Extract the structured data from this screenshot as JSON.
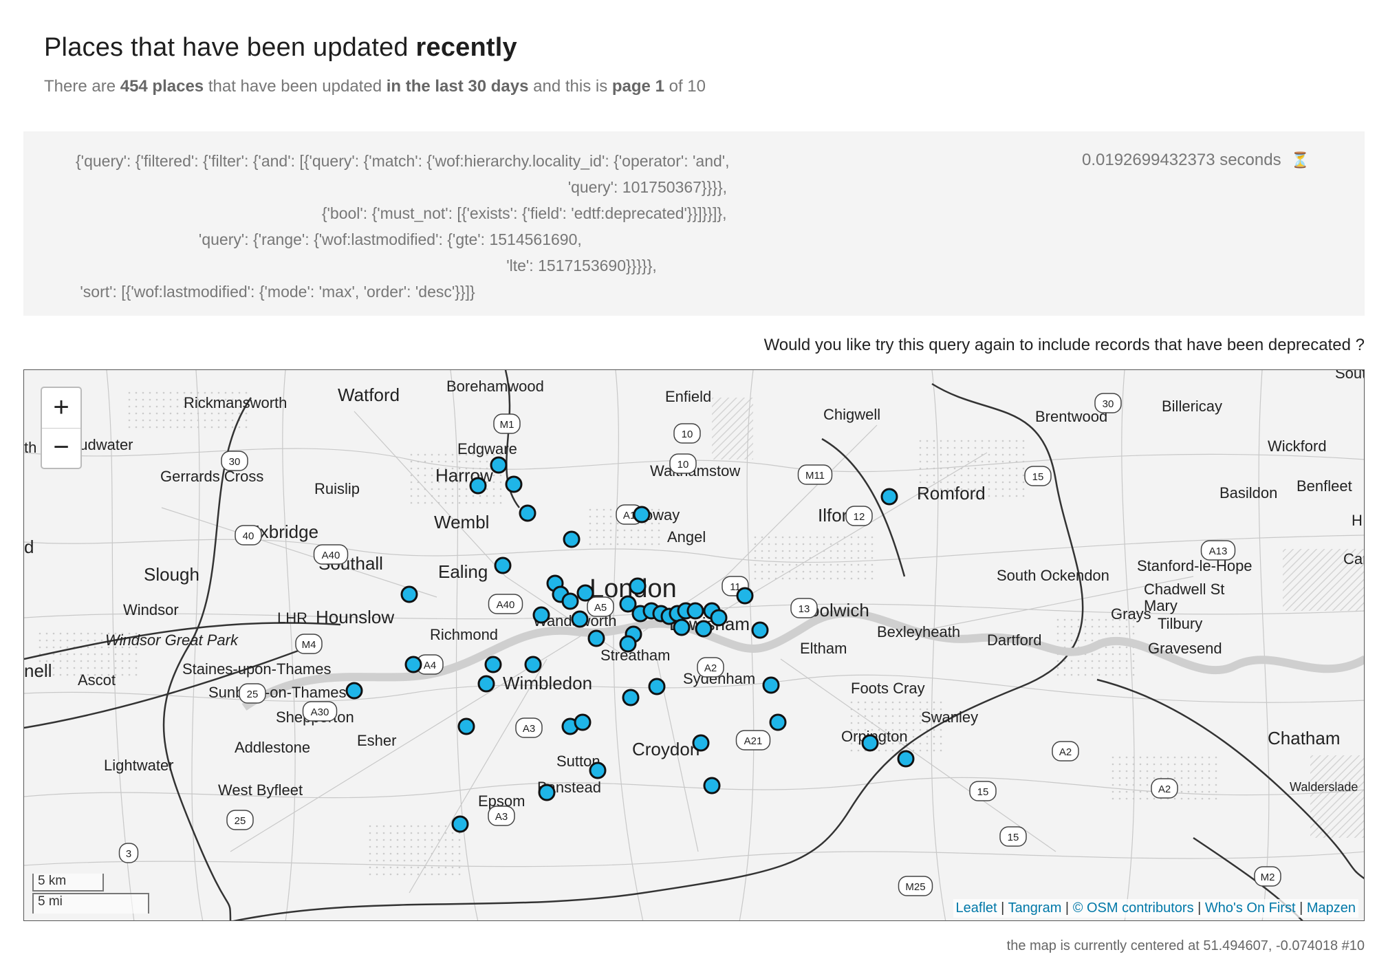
{
  "header": {
    "title_prefix": "Places that have been updated ",
    "title_emph": "recently",
    "subtitle": {
      "t1": "There are ",
      "count": "454 places",
      "t2": " that have been updated ",
      "window": "in the last 30 days",
      "t3": " and this is ",
      "page": "page 1",
      "t4": " of 10"
    }
  },
  "query": {
    "text": "{'query': {'filtered': {'filter': {'and': [{'query': {'match': {'wof:hierarchy.locality_id': {'operator': 'and',\n                                                                                                                'query': 101750367}}}},\n                                                        {'bool': {'must_not': [{'exists': {'field': 'edtf:deprecated'}}]}}]},\n                            'query': {'range': {'wof:lastmodified': {'gte': 1514561690,\n                                                                                                  'lte': 1517153690}}}}},\n 'sort': [{'wof:lastmodified': {'mode': 'max', 'order': 'desc'}}]}",
    "timing": "0.0192699432373 seconds",
    "timing_icon": "hourglass-icon"
  },
  "deprecated_prompt": "Would you like try this query again to include records that have been deprecated ?",
  "map": {
    "zoom_in": "+",
    "zoom_out": "−",
    "scale_km": "5 km",
    "scale_mi": "5 mi",
    "attribution": {
      "leaflet": "Leaflet",
      "tangram": "Tangram",
      "osm": "© OSM contributors",
      "wof": "Who's On First",
      "mapzen": "Mapzen",
      "sep": " | "
    },
    "marker_color": "#1fb5e8",
    "labels": {
      "watford": "Watford",
      "borehamwood": "Borehamwood",
      "enfield": "Enfield",
      "rickmansworth": "Rickmansworth",
      "chigwell": "Chigwell",
      "brentwood": "Brentwood",
      "billericay": "Billericay",
      "edgware": "Edgware",
      "wickford": "Wickford",
      "harrow": "Harrow",
      "walthamstow": "Walthamstow",
      "gerrards_cross": "Gerrards Cross",
      "ruislip": "Ruislip",
      "romford": "Romford",
      "basildon": "Basildon",
      "benfleet": "Benfleet",
      "holloway": "Holloway",
      "ilford": "Ilford",
      "wembley": "Wembl",
      "uxbridge": "Uxbridge",
      "angel": "Angel",
      "southall": "Southall",
      "ealing": "Ealing",
      "slough": "Slough",
      "london": "London",
      "stanford": "Stanford-le-Hope",
      "south_ockendon": "South Ockendon",
      "chadwell": "Chadwell St",
      "mary": "Mary",
      "windsor": "Windsor",
      "hounslow": "Hounslow",
      "lhr": "LHR",
      "woolwich": "Woolwich",
      "lewisham": "Lewisham",
      "wandsworth": "Wandsworth",
      "grays": "Grays",
      "tilbury": "Tilbury",
      "richmond": "Richmond",
      "bexleyheath": "Bexleyheath",
      "dartford": "Dartford",
      "windsor_great_park": "Windsor Great Park",
      "eltham": "Eltham",
      "gravesend": "Gravesend",
      "streatham": "Streatham",
      "staines": "Staines-upon-Thames",
      "sydenham": "Sydenham",
      "wimbledon": "Wimbledon",
      "ascot": "Ascot",
      "foots_cray": "Foots Cray",
      "sunbury": "Sunbury-on-Thames",
      "shepperton": "Shepperton",
      "swanley": "Swanley",
      "orpington": "Orpington",
      "chatham": "Chatham",
      "addlestone": "Addlestone",
      "esher": "Esher",
      "croydon": "Croydon",
      "sutton": "Sutton",
      "lightwater": "Lightwater",
      "banstead": "Banstead",
      "west_byfleet": "West Byfleet",
      "oudwater": "oudwater",
      "nell": "nell",
      "d": "d",
      "sout": "Sout",
      "can": "Can",
      "h": "H",
      "th": "th",
      "waldenslade": "Walderslade",
      "epsom": "Epsom"
    },
    "road_shields": {
      "m1": "M1",
      "r30_a": "30",
      "r10_a": "10",
      "r10_b": "10",
      "r30_b": "30",
      "m11": "M11",
      "r15_a": "15",
      "r12": "12",
      "a1": "A1",
      "r40": "40",
      "a40_a": "A40",
      "a13": "A13",
      "a40_b": "A40",
      "a5": "A5",
      "r11": "11",
      "r13": "13",
      "m4": "M4",
      "a4": "A4",
      "a2_a": "A2",
      "r25_a": "25",
      "a30": "A30",
      "a3_a": "A3",
      "a21": "A21",
      "a2_b": "A2",
      "r15_b": "15",
      "a2_c": "A2",
      "r25_b": "25",
      "a3_b": "A3",
      "r3": "3",
      "r15_c": "15",
      "m25": "M25",
      "m2": "M2"
    }
  },
  "footer": {
    "centered_text": "the map is currently centered at 51.494607, -0.074018 #10"
  }
}
